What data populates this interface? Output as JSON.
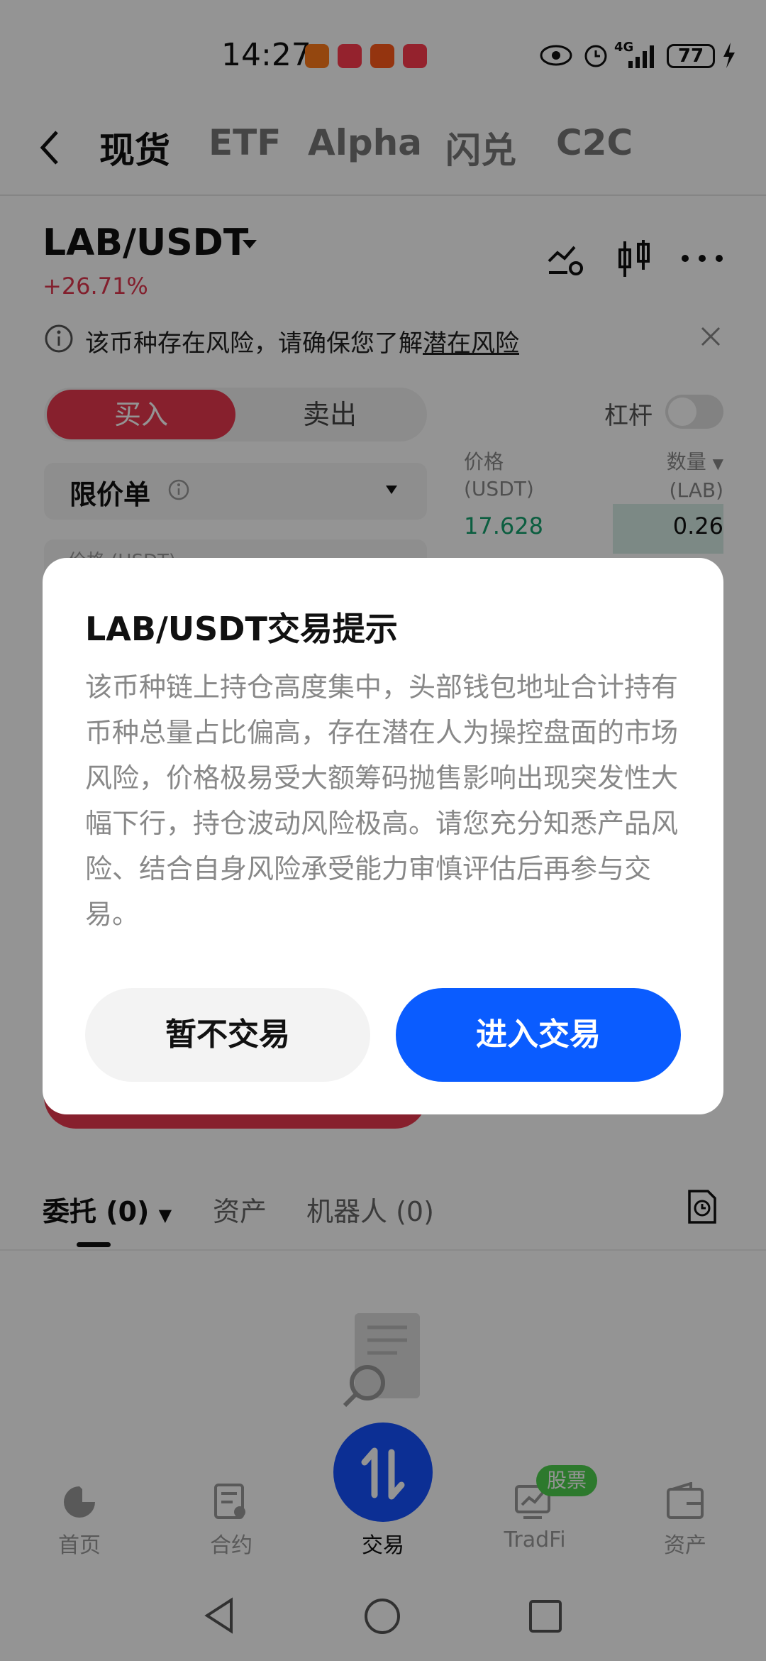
{
  "status_bar": {
    "time": "14:27",
    "network": "4G",
    "battery": "77",
    "icons": [
      "eye-icon",
      "alarm-icon",
      "signal-icon",
      "charging-icon"
    ]
  },
  "top_tabs": [
    "现货",
    "ETF",
    "Alpha",
    "闪兑",
    "C2C"
  ],
  "pair": {
    "name": "LAB/USDT",
    "change": "+26.71%"
  },
  "risk_notice": {
    "text": "该币种存在风险，请确保您了解",
    "link": "潜在风险"
  },
  "trade_panel": {
    "buy_label": "买入",
    "sell_label": "卖出",
    "leverage_label": "杠杆",
    "order_type": "限价单",
    "price_label": "价格 (USDT)"
  },
  "order_book": {
    "price_header": "价格",
    "price_unit": "(USDT)",
    "qty_header": "数量",
    "qty_unit": "(LAB)",
    "price": "17.628",
    "qty": "0.26"
  },
  "bottom_tabs": {
    "orders": "委托 (0)",
    "assets": "资产",
    "bots": "机器人 (0)"
  },
  "bottom_nav": [
    {
      "label": "首页",
      "icon": "home-icon"
    },
    {
      "label": "合约",
      "icon": "contract-icon"
    },
    {
      "label": "交易",
      "icon": "trade-icon"
    },
    {
      "label": "TradFi",
      "icon": "tradfi-icon"
    },
    {
      "label": "资产",
      "icon": "wallet-icon"
    }
  ],
  "stock_badge": "股票",
  "modal": {
    "title": "LAB/USDT交易提示",
    "body": "该币种链上持仓高度集中，头部钱包地址合计持有币种总量占比偏高，存在潜在人为操控盘面的市场风险，价格极易受大额筹码抛售影响出现突发性大幅下行，持仓波动风险极高。请您充分知悉产品风险、结合自身风险承受能力审慎评估后再参与交易。",
    "decline_label": "暂不交易",
    "enter_label": "进入交易"
  },
  "colors": {
    "accent_red": "#e8384f",
    "accent_blue": "#0a5cff",
    "green": "#16a36f"
  }
}
